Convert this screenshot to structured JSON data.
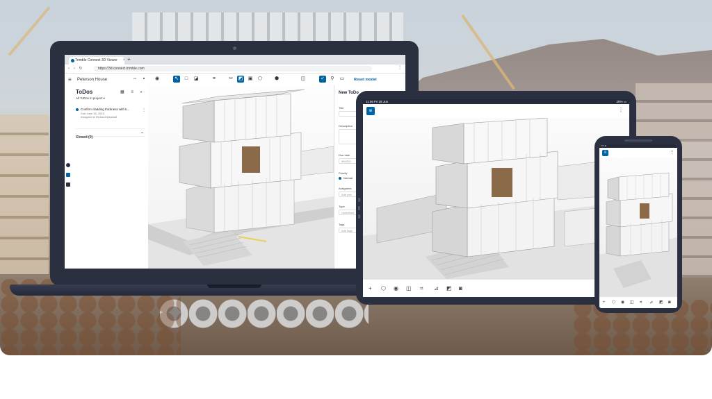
{
  "browser": {
    "tab_title": "Trimble Connect 3D Viewer",
    "tab_close": "×",
    "new_tab": "+",
    "url": "https://3d.connect.trimble.com",
    "nav_icons": "‹ › ↻",
    "menu_icon": "⋮"
  },
  "app": {
    "menu_icon": "≡",
    "project_name": "Peterson House",
    "reset_label": "Reset model"
  },
  "todos": {
    "title": "ToDos",
    "filter": "All ToDos in project ▾",
    "item_title": "Confirm cladding thickness with k...",
    "item_due": "Due June 28, 2019",
    "item_assignee": "Assigned to Richard Marshall",
    "item_more": "⋮",
    "closed_label": "Closed (0)",
    "chevron": "⌄"
  },
  "new_todo": {
    "title": "New ToDo",
    "title_label": "Title",
    "description_label": "Description",
    "due_date_label": "Due date",
    "due_date_placeholder": "MM/DD",
    "priority_label": "Priority",
    "priority_value": "Normal",
    "assignees_label": "Assignees",
    "assignees_placeholder": "Add peo",
    "type_label": "Type",
    "type_value": "Undefined",
    "tags_label": "Tags",
    "tags_placeholder": "Add tags"
  },
  "tablet": {
    "status_left": "11:06  Fri 28 Jun",
    "status_right": "20% ▭",
    "menu_icon": "≡",
    "kebab_icon": "⋮"
  },
  "phone": {
    "status": "▪▪▪ ●",
    "menu_icon": "≡",
    "kebab_icon": "⋮"
  },
  "colors": {
    "accent": "#0063a3",
    "device_frame": "#2b3040"
  }
}
